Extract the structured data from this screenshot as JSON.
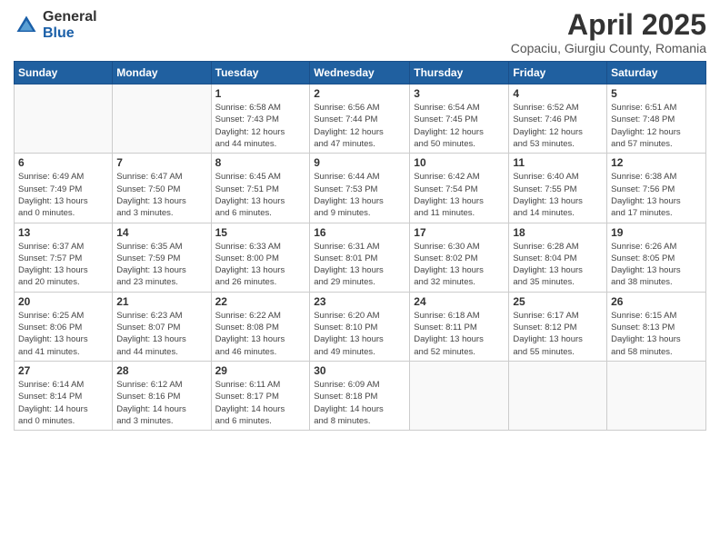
{
  "logo": {
    "general": "General",
    "blue": "Blue"
  },
  "title": "April 2025",
  "subtitle": "Copaciu, Giurgiu County, Romania",
  "days_of_week": [
    "Sunday",
    "Monday",
    "Tuesday",
    "Wednesday",
    "Thursday",
    "Friday",
    "Saturday"
  ],
  "weeks": [
    [
      {
        "day": "",
        "info": ""
      },
      {
        "day": "",
        "info": ""
      },
      {
        "day": "1",
        "info": "Sunrise: 6:58 AM\nSunset: 7:43 PM\nDaylight: 12 hours\nand 44 minutes."
      },
      {
        "day": "2",
        "info": "Sunrise: 6:56 AM\nSunset: 7:44 PM\nDaylight: 12 hours\nand 47 minutes."
      },
      {
        "day": "3",
        "info": "Sunrise: 6:54 AM\nSunset: 7:45 PM\nDaylight: 12 hours\nand 50 minutes."
      },
      {
        "day": "4",
        "info": "Sunrise: 6:52 AM\nSunset: 7:46 PM\nDaylight: 12 hours\nand 53 minutes."
      },
      {
        "day": "5",
        "info": "Sunrise: 6:51 AM\nSunset: 7:48 PM\nDaylight: 12 hours\nand 57 minutes."
      }
    ],
    [
      {
        "day": "6",
        "info": "Sunrise: 6:49 AM\nSunset: 7:49 PM\nDaylight: 13 hours\nand 0 minutes."
      },
      {
        "day": "7",
        "info": "Sunrise: 6:47 AM\nSunset: 7:50 PM\nDaylight: 13 hours\nand 3 minutes."
      },
      {
        "day": "8",
        "info": "Sunrise: 6:45 AM\nSunset: 7:51 PM\nDaylight: 13 hours\nand 6 minutes."
      },
      {
        "day": "9",
        "info": "Sunrise: 6:44 AM\nSunset: 7:53 PM\nDaylight: 13 hours\nand 9 minutes."
      },
      {
        "day": "10",
        "info": "Sunrise: 6:42 AM\nSunset: 7:54 PM\nDaylight: 13 hours\nand 11 minutes."
      },
      {
        "day": "11",
        "info": "Sunrise: 6:40 AM\nSunset: 7:55 PM\nDaylight: 13 hours\nand 14 minutes."
      },
      {
        "day": "12",
        "info": "Sunrise: 6:38 AM\nSunset: 7:56 PM\nDaylight: 13 hours\nand 17 minutes."
      }
    ],
    [
      {
        "day": "13",
        "info": "Sunrise: 6:37 AM\nSunset: 7:57 PM\nDaylight: 13 hours\nand 20 minutes."
      },
      {
        "day": "14",
        "info": "Sunrise: 6:35 AM\nSunset: 7:59 PM\nDaylight: 13 hours\nand 23 minutes."
      },
      {
        "day": "15",
        "info": "Sunrise: 6:33 AM\nSunset: 8:00 PM\nDaylight: 13 hours\nand 26 minutes."
      },
      {
        "day": "16",
        "info": "Sunrise: 6:31 AM\nSunset: 8:01 PM\nDaylight: 13 hours\nand 29 minutes."
      },
      {
        "day": "17",
        "info": "Sunrise: 6:30 AM\nSunset: 8:02 PM\nDaylight: 13 hours\nand 32 minutes."
      },
      {
        "day": "18",
        "info": "Sunrise: 6:28 AM\nSunset: 8:04 PM\nDaylight: 13 hours\nand 35 minutes."
      },
      {
        "day": "19",
        "info": "Sunrise: 6:26 AM\nSunset: 8:05 PM\nDaylight: 13 hours\nand 38 minutes."
      }
    ],
    [
      {
        "day": "20",
        "info": "Sunrise: 6:25 AM\nSunset: 8:06 PM\nDaylight: 13 hours\nand 41 minutes."
      },
      {
        "day": "21",
        "info": "Sunrise: 6:23 AM\nSunset: 8:07 PM\nDaylight: 13 hours\nand 44 minutes."
      },
      {
        "day": "22",
        "info": "Sunrise: 6:22 AM\nSunset: 8:08 PM\nDaylight: 13 hours\nand 46 minutes."
      },
      {
        "day": "23",
        "info": "Sunrise: 6:20 AM\nSunset: 8:10 PM\nDaylight: 13 hours\nand 49 minutes."
      },
      {
        "day": "24",
        "info": "Sunrise: 6:18 AM\nSunset: 8:11 PM\nDaylight: 13 hours\nand 52 minutes."
      },
      {
        "day": "25",
        "info": "Sunrise: 6:17 AM\nSunset: 8:12 PM\nDaylight: 13 hours\nand 55 minutes."
      },
      {
        "day": "26",
        "info": "Sunrise: 6:15 AM\nSunset: 8:13 PM\nDaylight: 13 hours\nand 58 minutes."
      }
    ],
    [
      {
        "day": "27",
        "info": "Sunrise: 6:14 AM\nSunset: 8:14 PM\nDaylight: 14 hours\nand 0 minutes."
      },
      {
        "day": "28",
        "info": "Sunrise: 6:12 AM\nSunset: 8:16 PM\nDaylight: 14 hours\nand 3 minutes."
      },
      {
        "day": "29",
        "info": "Sunrise: 6:11 AM\nSunset: 8:17 PM\nDaylight: 14 hours\nand 6 minutes."
      },
      {
        "day": "30",
        "info": "Sunrise: 6:09 AM\nSunset: 8:18 PM\nDaylight: 14 hours\nand 8 minutes."
      },
      {
        "day": "",
        "info": ""
      },
      {
        "day": "",
        "info": ""
      },
      {
        "day": "",
        "info": ""
      }
    ]
  ]
}
